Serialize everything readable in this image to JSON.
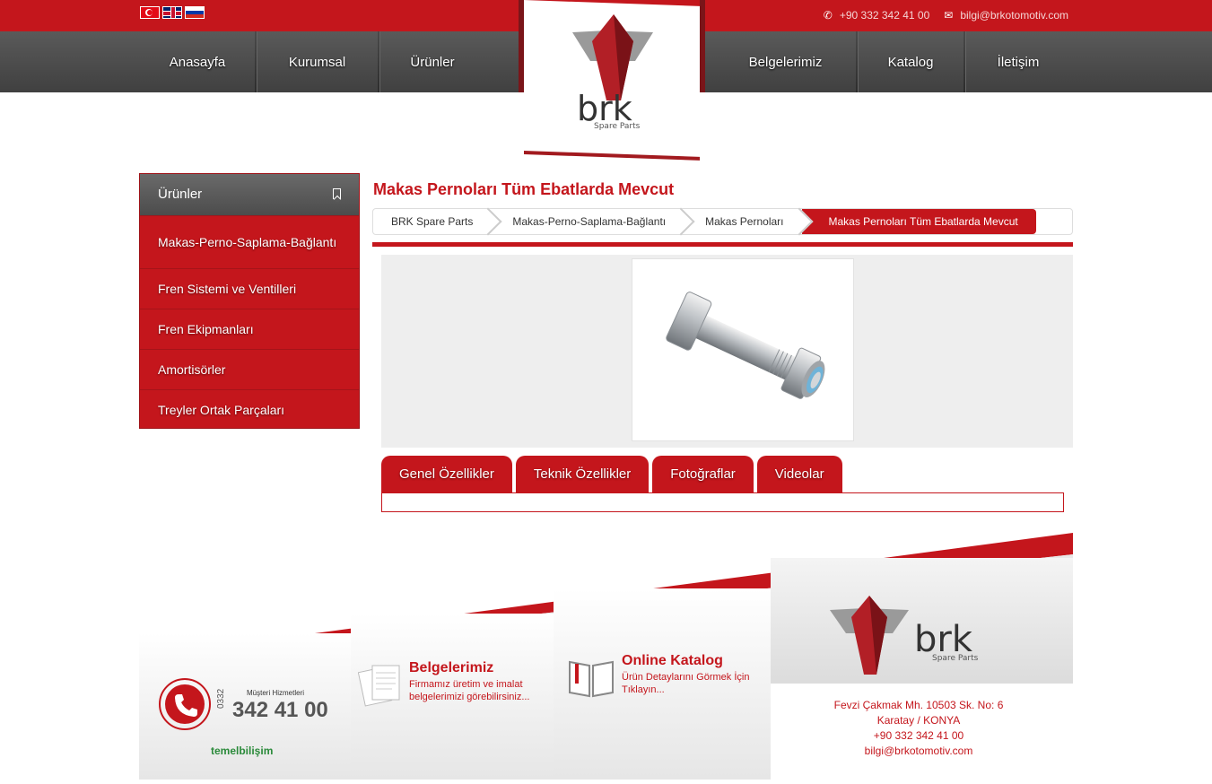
{
  "header": {
    "phone": "+90 332 342 41 00",
    "email": "bilgi@brkotomotiv.com",
    "languages": [
      "tr",
      "en",
      "ru"
    ]
  },
  "nav": {
    "items": [
      "Anasayfa",
      "Kurumsal",
      "Ürünler",
      "Belgelerimiz",
      "Katalog",
      "İletişim"
    ]
  },
  "logo": {
    "text": "brk",
    "subtext": "Spare Parts"
  },
  "sidebar": {
    "title": "Ürünler",
    "items": [
      "Makas-Perno-Saplama-Bağlantı",
      "Fren Sistemi ve Ventilleri",
      "Fren Ekipmanları",
      "Amortisörler",
      "Treyler Ortak Parçaları"
    ]
  },
  "main": {
    "title": "Makas Pernoları Tüm Ebatlarda Mevcut",
    "breadcrumb": [
      "BRK Spare Parts",
      "Makas-Perno-Saplama-Bağlantı",
      "Makas Pernoları",
      "Makas Pernoları Tüm Ebatlarda Mevcut"
    ],
    "tabs": [
      "Genel Özellikler",
      "Teknik Özellikler",
      "Fotoğraflar",
      "Videolar"
    ]
  },
  "footer": {
    "service_label": "Müşteri Hizmetleri",
    "service_prefix": "0332",
    "service_number": "342 41 00",
    "credit": "temelbilişim",
    "docs_title": "Belgelerimiz",
    "docs_text": "Firmamız üretim ve imalat belgelerimizi görebilirsiniz...",
    "catalog_title": "Online Katalog",
    "catalog_text": "Ürün Detaylarını Görmek İçin Tıklayın...",
    "address_line1": "Fevzi Çakmak Mh. 10503 Sk. No: 6",
    "address_line2": "Karatay / KONYA",
    "phone": "+90 332 342 41 00",
    "email": "bilgi@brkotomotiv.com"
  },
  "colors": {
    "brand": "#c4161c",
    "nav": "#4c4c4c"
  }
}
